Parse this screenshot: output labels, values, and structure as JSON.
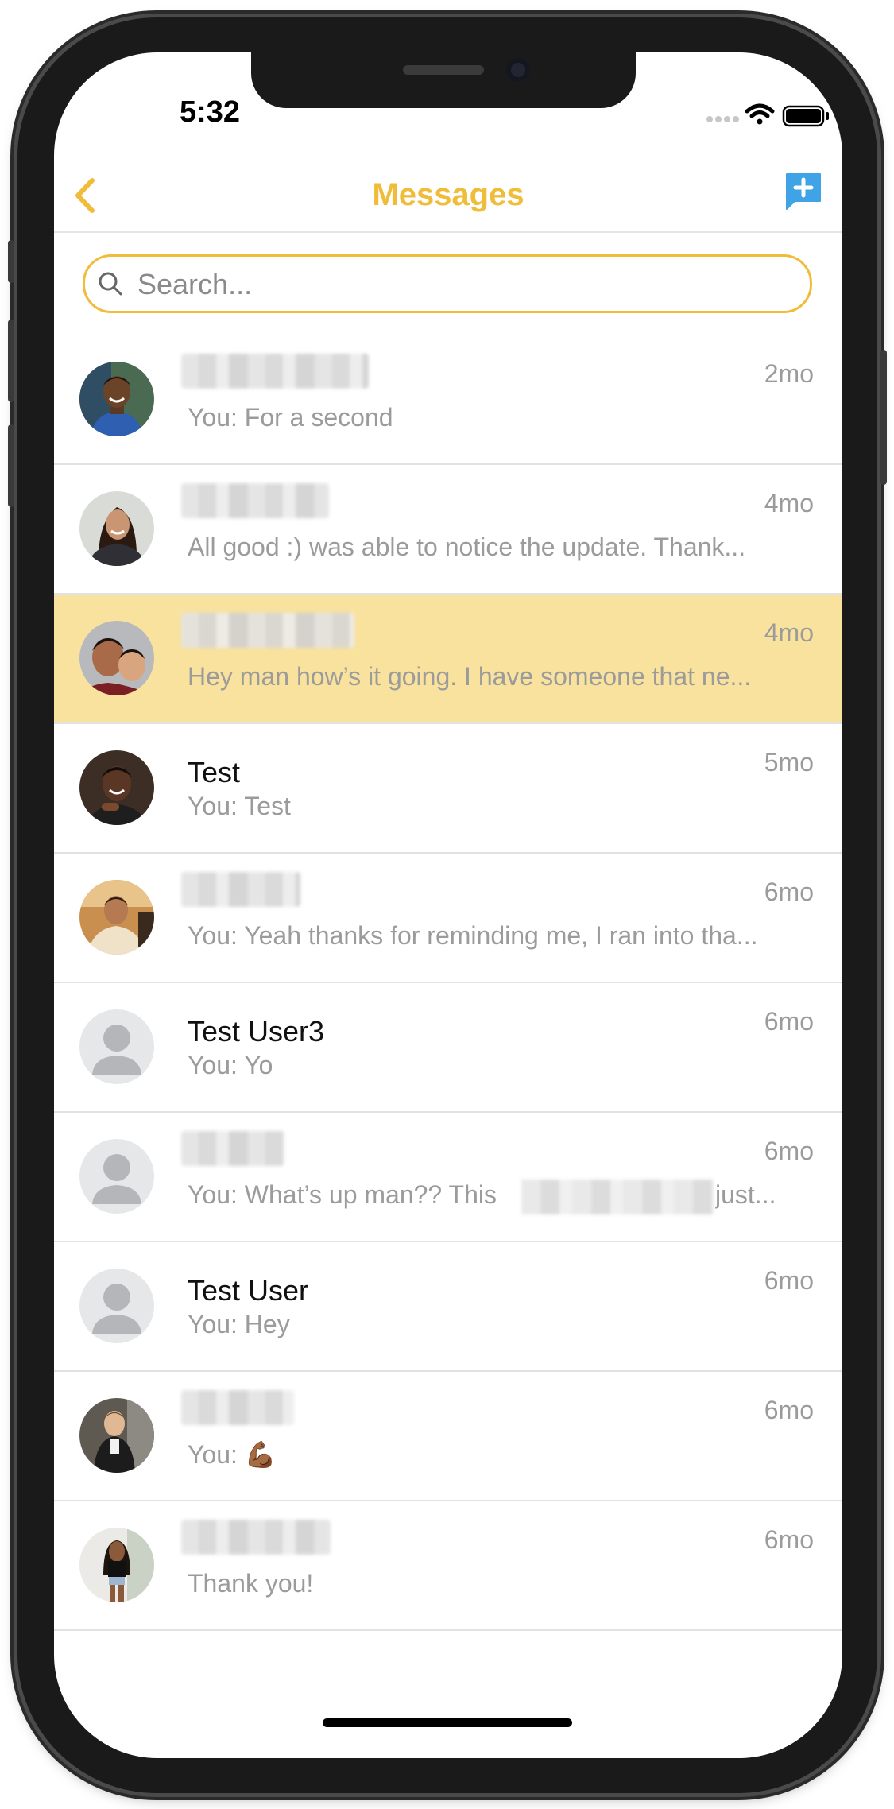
{
  "status_bar": {
    "time": "5:32",
    "icons": [
      "signal-dots-icon",
      "wifi-icon",
      "battery-icon"
    ]
  },
  "nav": {
    "back_icon": "chevron-left-icon",
    "title": "Messages",
    "compose_icon": "new-message-icon",
    "accent_color": "#f0bd3a",
    "compose_color": "#3fa3e6"
  },
  "search": {
    "placeholder": "Search...",
    "value": ""
  },
  "conversations": [
    {
      "name": "",
      "name_hidden": true,
      "preview": "You: For a second",
      "time": "2mo",
      "avatar": "photo-man-blue-shirt",
      "highlighted": false
    },
    {
      "name": "",
      "name_hidden": true,
      "preview": "All good :) was able to notice the update. Thank...",
      "time": "4mo",
      "avatar": "photo-woman-smiling",
      "highlighted": false
    },
    {
      "name": "",
      "name_hidden": true,
      "preview": "Hey man how’s it going. I have someone that ne...",
      "time": "4mo",
      "avatar": "photo-man-and-child",
      "highlighted": true
    },
    {
      "name": "Test",
      "name_hidden": false,
      "preview": "You: Test",
      "time": "5mo",
      "avatar": "photo-man-smiling",
      "highlighted": false
    },
    {
      "name": "",
      "name_hidden": true,
      "preview": "You: Yeah thanks for reminding me, I ran into tha...",
      "time": "6mo",
      "avatar": "photo-man-outdoors",
      "highlighted": false
    },
    {
      "name": "Test User3",
      "name_hidden": false,
      "preview": "You: Yo",
      "time": "6mo",
      "avatar": "default-avatar",
      "highlighted": false
    },
    {
      "name": "",
      "name_hidden": true,
      "preview": "You: What’s up man?? This",
      "preview_tail": "just...",
      "preview_partially_hidden": true,
      "time": "6mo",
      "avatar": "default-avatar",
      "highlighted": false
    },
    {
      "name": "Test User",
      "name_hidden": false,
      "preview": "You: Hey",
      "time": "6mo",
      "avatar": "default-avatar",
      "highlighted": false
    },
    {
      "name": "",
      "name_hidden": true,
      "preview": "You: 💪🏾",
      "time": "6mo",
      "avatar": "photo-man-standing",
      "highlighted": false
    },
    {
      "name": "",
      "name_hidden": true,
      "preview": "Thank you!",
      "time": "6mo",
      "avatar": "photo-woman-standing",
      "highlighted": false
    }
  ]
}
